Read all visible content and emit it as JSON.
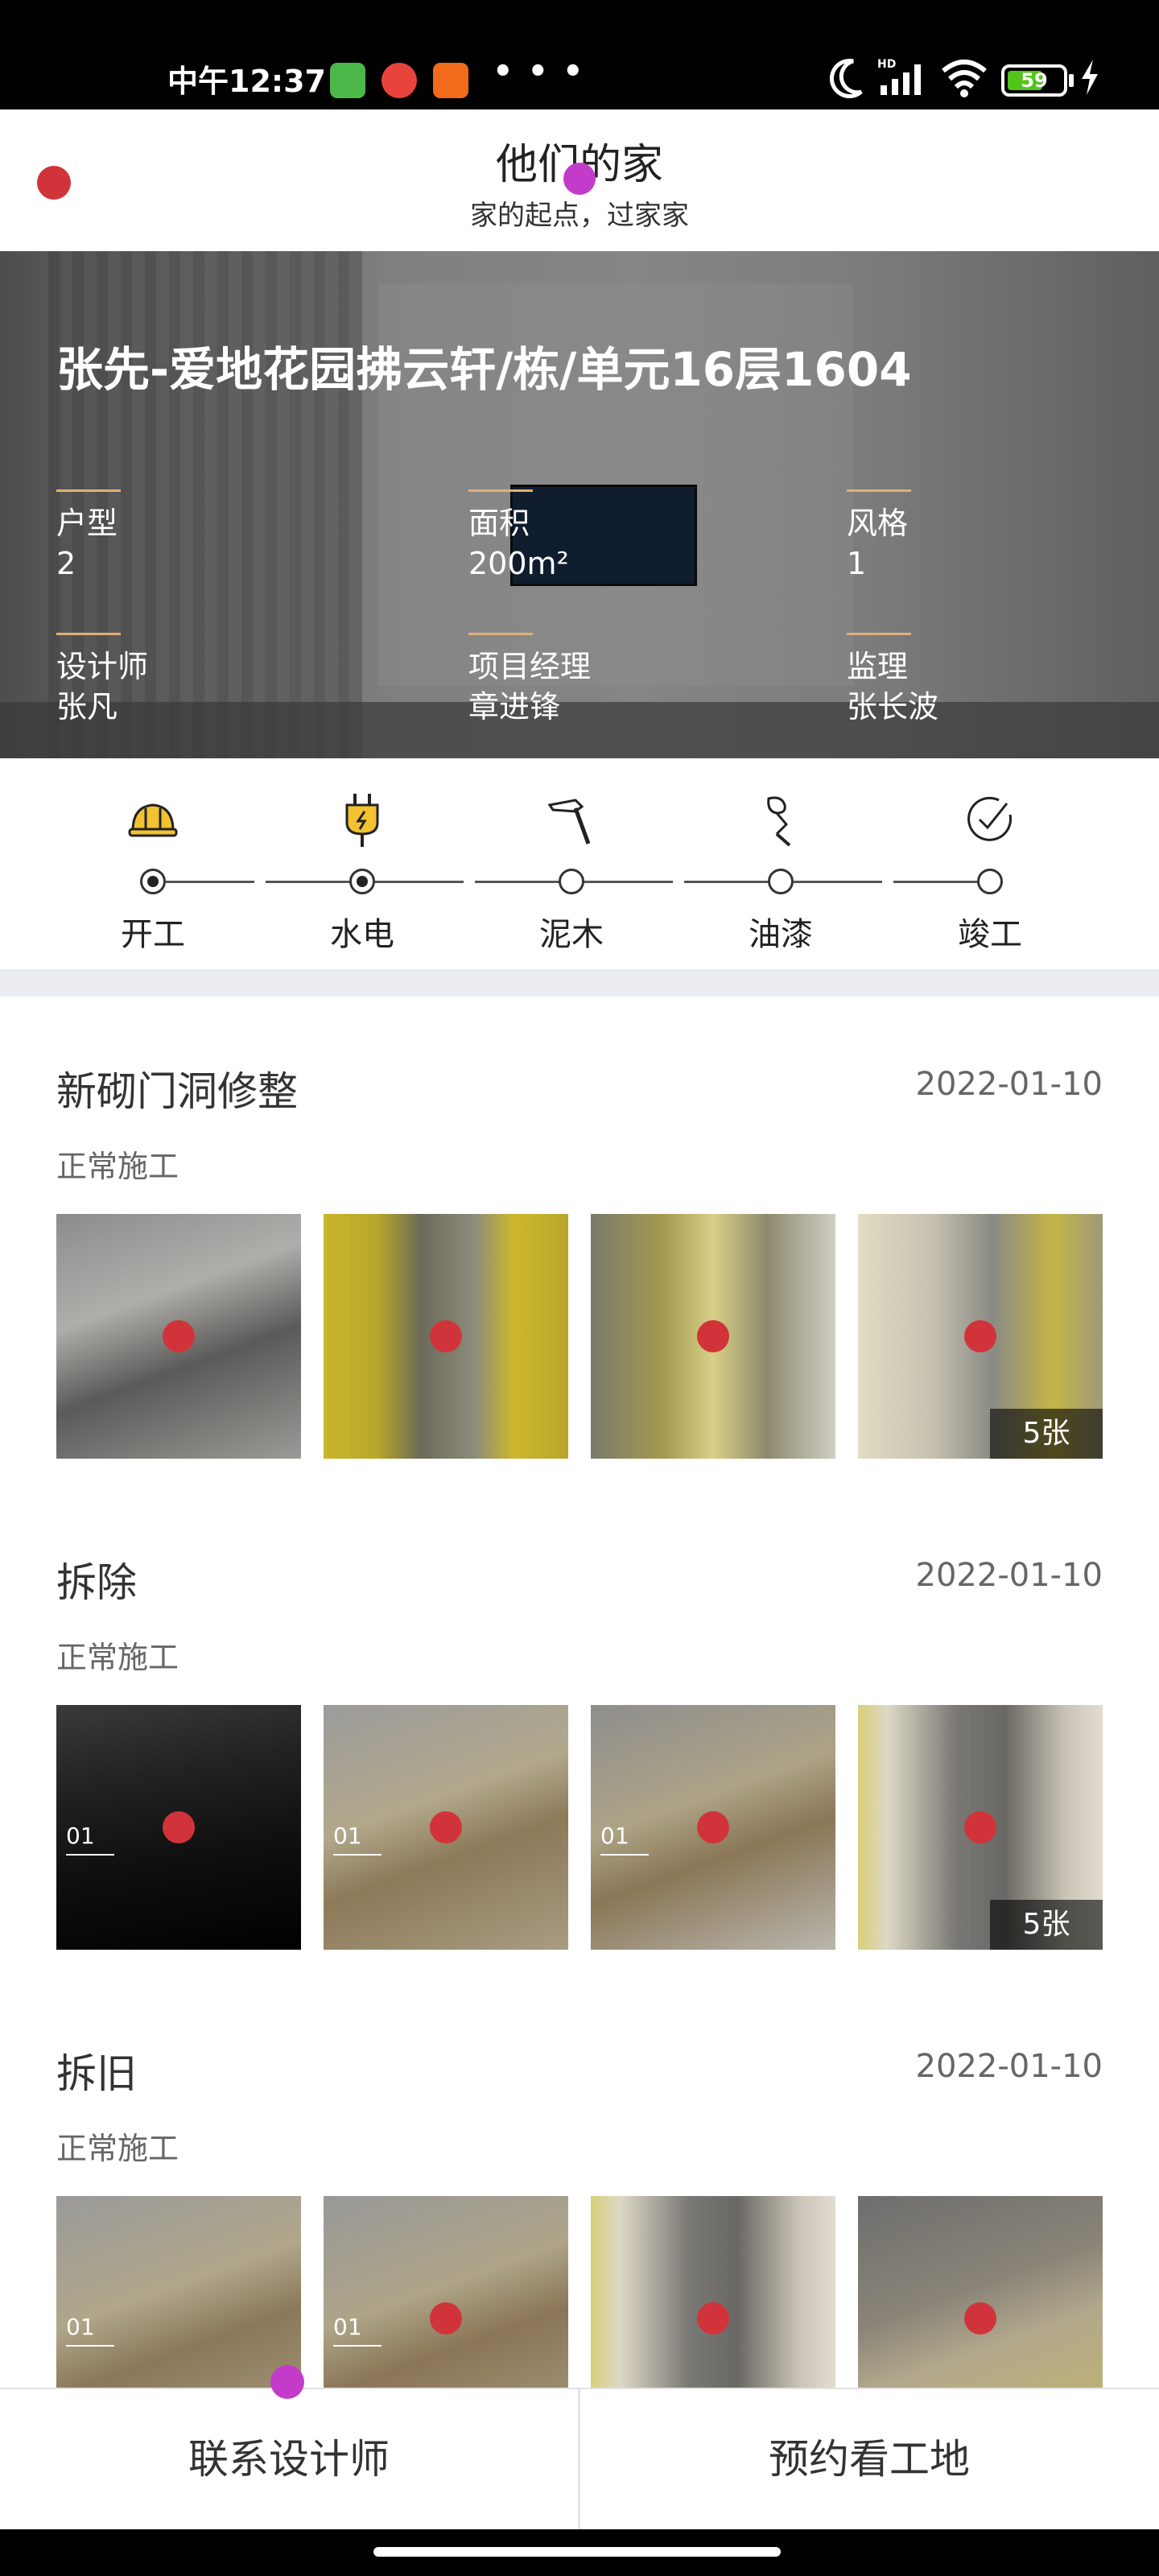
{
  "status_bar": {
    "time": "中午12:37",
    "more": "• • •",
    "battery_level": "59",
    "battery_fraction": 0.59,
    "app_icons": [
      "wechat-icon",
      "mascot-icon",
      "home-app-icon"
    ],
    "app_colors": [
      "#4cb84a",
      "#e8433c",
      "#f26a1b"
    ]
  },
  "header": {
    "title": "他们的家",
    "subtitle": "家的起点，过家家"
  },
  "hero": {
    "title": "张先-爱地花园拂云轩/栋/单元16层1604",
    "fields": [
      {
        "label": "户型",
        "value": "2"
      },
      {
        "label": "面积",
        "value": "200m²"
      },
      {
        "label": "风格",
        "value": "1"
      },
      {
        "label": "设计师",
        "value": "张凡"
      },
      {
        "label": "项目经理",
        "value": "章进锋"
      },
      {
        "label": "监理",
        "value": "张长波"
      }
    ]
  },
  "progress": {
    "steps": [
      {
        "label": "开工",
        "icon": "hard-hat-icon",
        "done": true
      },
      {
        "label": "水电",
        "icon": "plug-icon",
        "done": true
      },
      {
        "label": "泥木",
        "icon": "hammer-icon",
        "done": false
      },
      {
        "label": "油漆",
        "icon": "paint-icon",
        "done": false
      },
      {
        "label": "竣工",
        "icon": "check-circle-icon",
        "done": false
      }
    ],
    "accent": "#f2c230"
  },
  "records": [
    {
      "title": "新砌门洞修整",
      "date": "2022-01-10",
      "status": "正常施工",
      "badge": "5张"
    },
    {
      "title": "拆除",
      "date": "2022-01-10",
      "status": "正常施工",
      "badge": "5张",
      "stamp_day": "01"
    },
    {
      "title": "拆旧",
      "date": "2022-01-10",
      "status": "正常施工",
      "stamp_day": "01"
    }
  ],
  "bottom_bar": {
    "contact_label": "联系设计师",
    "appointment_label": "预约看工地"
  }
}
